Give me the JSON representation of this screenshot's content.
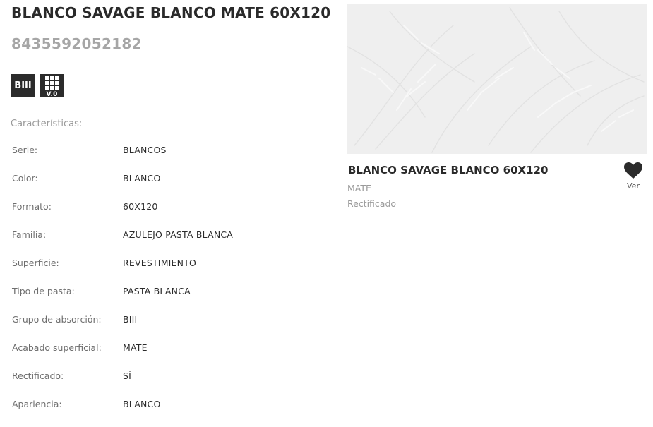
{
  "product": {
    "title": "BLANCO SAVAGE BLANCO MATE 60X120",
    "ean": "8435592052182"
  },
  "badges": {
    "absorption": "BIII",
    "version": "V.0"
  },
  "characteristics_heading": "Características:",
  "specs": [
    {
      "label": "Serie:",
      "value": "BLANCOS"
    },
    {
      "label": "Color:",
      "value": "BLANCO"
    },
    {
      "label": "Formato:",
      "value": "60X120"
    },
    {
      "label": "Familia:",
      "value": "AZULEJO PASTA BLANCA"
    },
    {
      "label": "Superficie:",
      "value": "REVESTIMIENTO"
    },
    {
      "label": "Tipo de pasta:",
      "value": "PASTA BLANCA"
    },
    {
      "label": "Grupo de absorción:",
      "value": "BIII"
    },
    {
      "label": "Acabado superficial:",
      "value": "MATE"
    },
    {
      "label": "Rectificado:",
      "value": "SÍ"
    },
    {
      "label": "Apariencia:",
      "value": "BLANCO"
    }
  ],
  "card": {
    "title": "BLANCO SAVAGE BLANCO 60X120",
    "finish": "MATE",
    "rectified": "Rectificado",
    "favorite_label": "Ver",
    "favorite_icon": "heart-icon"
  },
  "colors": {
    "text_dark": "#2b2b2b",
    "text_muted": "#9a9a9a",
    "ean_gray": "#a6a6a6",
    "image_bg": "#efefef"
  }
}
